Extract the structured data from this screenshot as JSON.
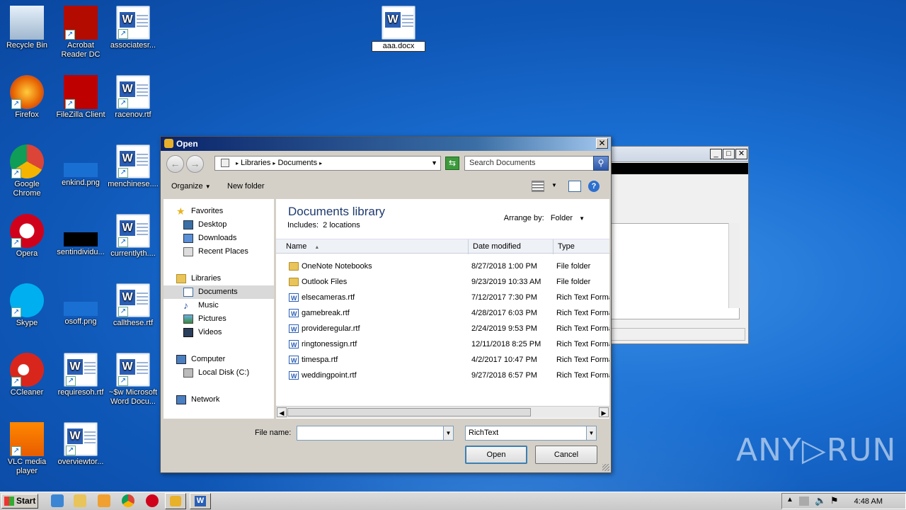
{
  "desktop": {
    "icons": [
      {
        "label": "Recycle Bin",
        "icon": "recycle-bin-icon"
      },
      {
        "label": "Acrobat Reader DC",
        "icon": "acrobat-icon"
      },
      {
        "label": "associatesr...",
        "icon": "word-doc-icon"
      },
      {
        "label": "Firefox",
        "icon": "firefox-icon"
      },
      {
        "label": "FileZilla Client",
        "icon": "filezilla-icon"
      },
      {
        "label": "racenov.rtf",
        "icon": "word-doc-icon"
      },
      {
        "label": "Google Chrome",
        "icon": "chrome-icon"
      },
      {
        "label": "enkind.png",
        "icon": "image-icon"
      },
      {
        "label": "menchinese....",
        "icon": "word-doc-icon"
      },
      {
        "label": "Opera",
        "icon": "opera-icon"
      },
      {
        "label": "sentindividu...",
        "icon": "image-icon"
      },
      {
        "label": "currentlyth....",
        "icon": "word-doc-icon"
      },
      {
        "label": "Skype",
        "icon": "skype-icon"
      },
      {
        "label": "osoff.png",
        "icon": "image-icon"
      },
      {
        "label": "callthese.rtf",
        "icon": "word-doc-icon"
      },
      {
        "label": "CCleaner",
        "icon": "ccleaner-icon"
      },
      {
        "label": "requiresoh.rtf",
        "icon": "word-doc-icon"
      },
      {
        "label": "~$w Microsoft Word Docu...",
        "icon": "word-doc-icon"
      },
      {
        "label": "VLC media player",
        "icon": "vlc-icon"
      },
      {
        "label": "overviewtor...",
        "icon": "word-doc-icon"
      },
      {
        "label": "aaa.docx",
        "icon": "word-doc-icon"
      }
    ]
  },
  "dialog": {
    "title": "Open",
    "close": "✕",
    "address": {
      "crumbs": [
        "Libraries",
        "Documents"
      ],
      "sep": "▸"
    },
    "search_placeholder": "Search Documents",
    "toolbar": {
      "organize": "Organize",
      "new_folder": "New folder"
    },
    "nav": {
      "favorites": "Favorites",
      "desktop": "Desktop",
      "downloads": "Downloads",
      "recent": "Recent Places",
      "libraries": "Libraries",
      "documents": "Documents",
      "music": "Music",
      "pictures": "Pictures",
      "videos": "Videos",
      "computer": "Computer",
      "local_disk": "Local Disk (C:)",
      "network": "Network"
    },
    "library": {
      "title": "Documents library",
      "includes": "Includes:",
      "locations": "2 locations",
      "arrange_label": "Arrange by:",
      "arrange_value": "Folder"
    },
    "columns": {
      "name": "Name",
      "date": "Date modified",
      "type": "Type"
    },
    "files": [
      {
        "name": "OneNote Notebooks",
        "date": "8/27/2018 1:00 PM",
        "type": "File folder",
        "kind": "folder"
      },
      {
        "name": "Outlook Files",
        "date": "9/23/2019 10:33 AM",
        "type": "File folder",
        "kind": "folder"
      },
      {
        "name": "elsecameras.rtf",
        "date": "7/12/2017 7:30 PM",
        "type": "Rich Text Forma",
        "kind": "doc"
      },
      {
        "name": "gamebreak.rtf",
        "date": "4/28/2017 6:03 PM",
        "type": "Rich Text Forma",
        "kind": "doc"
      },
      {
        "name": "provideregular.rtf",
        "date": "2/24/2019 9:53 PM",
        "type": "Rich Text Forma",
        "kind": "doc"
      },
      {
        "name": "ringtonessign.rtf",
        "date": "12/11/2018 8:25 PM",
        "type": "Rich Text Forma",
        "kind": "doc"
      },
      {
        "name": "timespa.rtf",
        "date": "4/2/2017 10:47 PM",
        "type": "Rich Text Forma",
        "kind": "doc"
      },
      {
        "name": "weddingpoint.rtf",
        "date": "9/27/2018 6:57 PM",
        "type": "Rich Text Forma",
        "kind": "doc"
      }
    ],
    "file_name_label": "File name:",
    "file_name_value": "",
    "file_type": "RichText",
    "open_button": "Open",
    "cancel_button": "Cancel"
  },
  "taskbar": {
    "start": "Start",
    "clock": "4:48 AM"
  },
  "watermark": "ANY▷RUN",
  "colors": {
    "desktop": "#1a6fd2",
    "title_bar": "#0a246a",
    "dialog_bg": "#d4d0c8"
  }
}
